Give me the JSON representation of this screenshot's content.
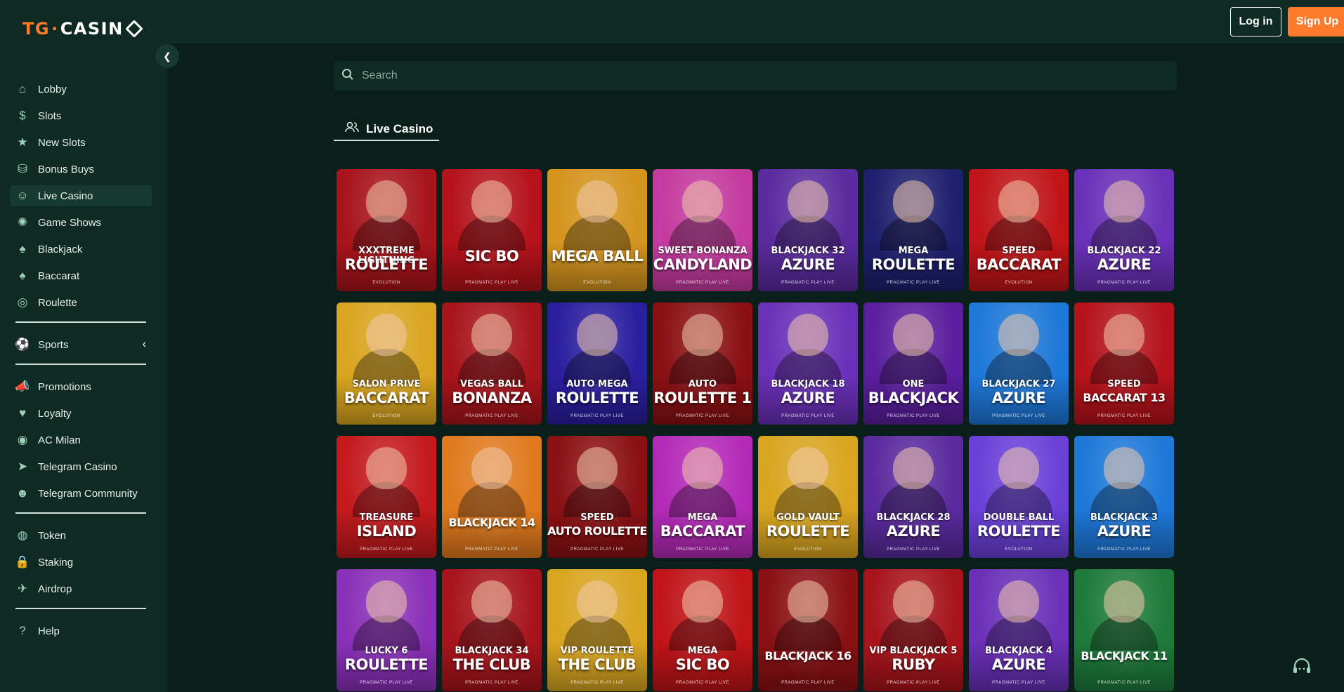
{
  "brand": {
    "tg": "TG",
    "dot": "·",
    "name": "CASIN"
  },
  "sidebar": {
    "items": [
      {
        "label": "Lobby",
        "icon": "home-icon",
        "glyph": "⌂"
      },
      {
        "label": "Slots",
        "icon": "dollar-coin-icon",
        "glyph": "$"
      },
      {
        "label": "New Slots",
        "icon": "star-icon",
        "glyph": "★"
      },
      {
        "label": "Bonus Buys",
        "icon": "coin-stack-icon",
        "glyph": "⛁"
      },
      {
        "label": "Live Casino",
        "icon": "users-icon",
        "glyph": "☺",
        "active": true
      },
      {
        "label": "Game Shows",
        "icon": "film-reel-icon",
        "glyph": "✺"
      },
      {
        "label": "Blackjack",
        "icon": "cards-icon",
        "glyph": "♠"
      },
      {
        "label": "Baccarat",
        "icon": "spade-icon",
        "glyph": "♠"
      },
      {
        "label": "Roulette",
        "icon": "roulette-icon",
        "glyph": "◎"
      }
    ],
    "sports": {
      "label": "Sports",
      "icon": "soccer-ball-icon",
      "glyph": "⚽"
    },
    "items2": [
      {
        "label": "Promotions",
        "icon": "megaphone-icon",
        "glyph": "📣"
      },
      {
        "label": "Loyalty",
        "icon": "heart-hand-icon",
        "glyph": "♥"
      },
      {
        "label": "AC Milan",
        "icon": "globe-icon",
        "glyph": "◉"
      },
      {
        "label": "Telegram Casino",
        "icon": "telegram-icon",
        "glyph": "➤"
      },
      {
        "label": "Telegram Community",
        "icon": "community-icon",
        "glyph": "☻"
      }
    ],
    "items3": [
      {
        "label": "Token",
        "icon": "token-icon",
        "glyph": "◍"
      },
      {
        "label": "Staking",
        "icon": "lock-icon",
        "glyph": "🔒"
      },
      {
        "label": "Airdrop",
        "icon": "plane-icon",
        "glyph": "✈"
      }
    ],
    "help": {
      "label": "Help",
      "icon": "help-icon",
      "glyph": "?"
    }
  },
  "header": {
    "login_label": "Log in",
    "signup_label": "Sign Up"
  },
  "search": {
    "placeholder": "Search"
  },
  "tab": {
    "label": "Live Casino"
  },
  "games": [
    {
      "t1": "XXXtreme Lightning",
      "t2": "Roulette",
      "prov": "Evolution",
      "bg": "#a8141c"
    },
    {
      "t1": "",
      "t2": "Sic Bo",
      "prov": "Pragmatic Play Live",
      "bg": "#b5121b"
    },
    {
      "t1": "",
      "t2": "Mega Ball",
      "prov": "Evolution",
      "bg": "#d4941e"
    },
    {
      "t1": "Sweet Bonanza",
      "t2": "Candyland",
      "prov": "Pragmatic Play Live",
      "bg": "#c43a9e"
    },
    {
      "t1": "Blackjack 32",
      "t2": "Azure",
      "prov": "Pragmatic Play Live",
      "bg": "#5a2a9e"
    },
    {
      "t1": "Mega",
      "t2": "Roulette",
      "prov": "Pragmatic Play Live",
      "bg": "#1e1f6e"
    },
    {
      "t1": "Speed",
      "t2": "Baccarat",
      "prov": "Evolution",
      "bg": "#c01418"
    },
    {
      "t1": "Blackjack 22",
      "t2": "Azure",
      "prov": "Pragmatic Play Live",
      "bg": "#6a30b8"
    },
    {
      "t1": "Salon Prive",
      "t2": "Baccarat",
      "prov": "Evolution",
      "bg": "#d9a520"
    },
    {
      "t1": "Vegas Ball",
      "t2": "Bonanza",
      "prov": "Pragmatic Play Live",
      "bg": "#a8141c"
    },
    {
      "t1": "Auto Mega",
      "t2": "Roulette",
      "prov": "Pragmatic Play Live",
      "bg": "#2a1e9e"
    },
    {
      "t1": "Auto",
      "t2": "Roulette 1",
      "prov": "Pragmatic Play Live",
      "bg": "#8a1014"
    },
    {
      "t1": "Blackjack 18",
      "t2": "Azure",
      "prov": "Pragmatic Play Live",
      "bg": "#6a30b8"
    },
    {
      "t1": "One",
      "t2": "Blackjack",
      "prov": "Pragmatic Play Live",
      "bg": "#5a1e9e"
    },
    {
      "t1": "Blackjack 27",
      "t2": "Azure",
      "prov": "Pragmatic Play Live",
      "bg": "#1e78d8"
    },
    {
      "t1": "Speed",
      "t2": "Baccarat 13",
      "prov": "Pragmatic Play Live",
      "bg": "#b5121b"
    },
    {
      "t1": "Treasure",
      "t2": "Island",
      "prov": "Pragmatic Play Live",
      "bg": "#c41a1e"
    },
    {
      "t1": "",
      "t2": "Blackjack 14",
      "prov": "Pragmatic Play Live",
      "bg": "#e07a1e"
    },
    {
      "t1": "Speed",
      "t2": "Auto Roulette",
      "prov": "Pragmatic Play Live",
      "bg": "#8a1014"
    },
    {
      "t1": "Mega",
      "t2": "Baccarat",
      "prov": "Pragmatic Play Live",
      "bg": "#b42ab8"
    },
    {
      "t1": "Gold Vault",
      "t2": "Roulette",
      "prov": "Evolution",
      "bg": "#d9a520"
    },
    {
      "t1": "Blackjack 28",
      "t2": "Azure",
      "prov": "Pragmatic Play Live",
      "bg": "#5a2a9e"
    },
    {
      "t1": "Double Ball",
      "t2": "Roulette",
      "prov": "Evolution",
      "bg": "#6a40d8"
    },
    {
      "t1": "Blackjack 3",
      "t2": "Azure",
      "prov": "Pragmatic Play Live",
      "bg": "#1e78d8"
    },
    {
      "t1": "Lucky 6",
      "t2": "Roulette",
      "prov": "Pragmatic Play Live",
      "bg": "#8a30b8"
    },
    {
      "t1": "Blackjack 34",
      "t2": "The Club",
      "prov": "Pragmatic Play Live",
      "bg": "#a8141c"
    },
    {
      "t1": "VIP Roulette",
      "t2": "The Club",
      "prov": "Pragmatic Play Live",
      "bg": "#d9a520"
    },
    {
      "t1": "Mega",
      "t2": "Sic Bo",
      "prov": "Pragmatic Play Live",
      "bg": "#c01418"
    },
    {
      "t1": "",
      "t2": "Blackjack 16",
      "prov": "Pragmatic Play Live",
      "bg": "#8a1014"
    },
    {
      "t1": "VIP Blackjack 5",
      "t2": "Ruby",
      "prov": "Pragmatic Play Live",
      "bg": "#a8141c"
    },
    {
      "t1": "Blackjack 4",
      "t2": "Azure",
      "prov": "Pragmatic Play Live",
      "bg": "#6a30b8"
    },
    {
      "t1": "",
      "t2": "Blackjack 11",
      "prov": "Pragmatic Play Live",
      "bg": "#1e7a3a"
    }
  ],
  "support": {
    "icon": "headset-icon"
  }
}
